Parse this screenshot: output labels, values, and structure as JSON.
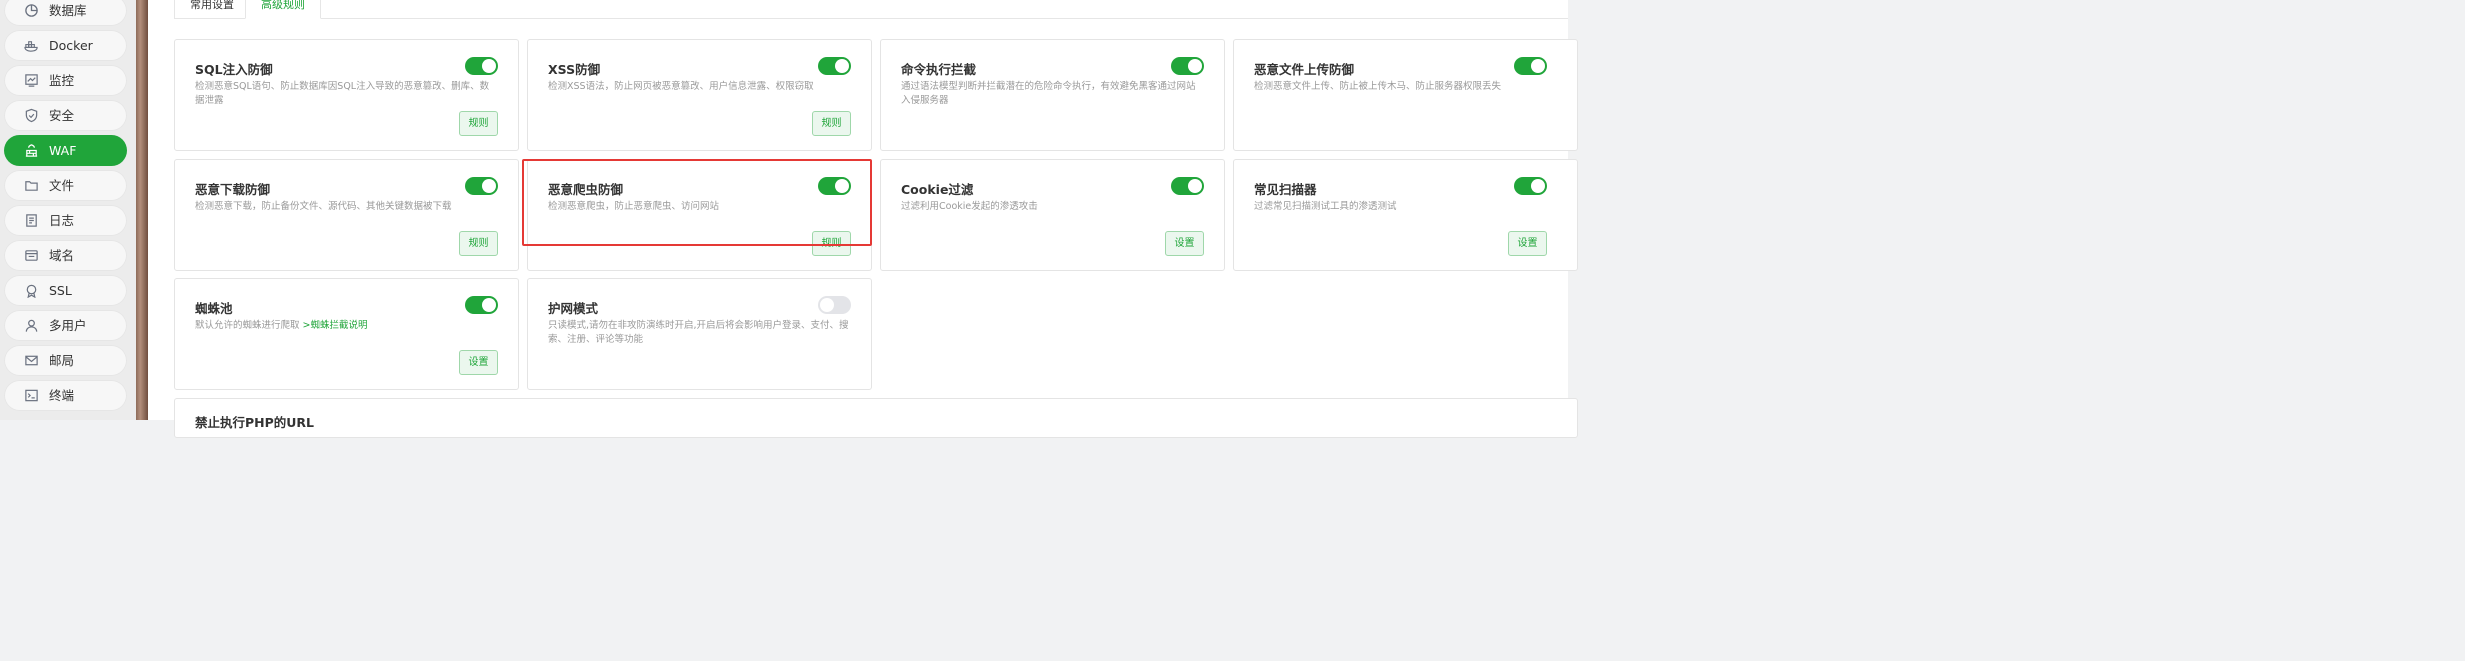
{
  "sidebar": {
    "items": [
      {
        "label": "数据库",
        "icon": "pie-chart-icon",
        "active": false
      },
      {
        "label": "Docker",
        "icon": "docker-icon",
        "active": false
      },
      {
        "label": "监控",
        "icon": "monitor-icon",
        "active": false
      },
      {
        "label": "安全",
        "icon": "shield-icon",
        "active": false
      },
      {
        "label": "WAF",
        "icon": "firewall-icon",
        "active": true
      },
      {
        "label": "文件",
        "icon": "folder-icon",
        "active": false
      },
      {
        "label": "日志",
        "icon": "log-icon",
        "active": false
      },
      {
        "label": "域名",
        "icon": "globe-icon",
        "active": false
      },
      {
        "label": "SSL",
        "icon": "ssl-icon",
        "active": false
      },
      {
        "label": "多用户",
        "icon": "users-icon",
        "active": false
      },
      {
        "label": "邮局",
        "icon": "mail-icon",
        "active": false
      },
      {
        "label": "终端",
        "icon": "terminal-icon",
        "active": false
      }
    ]
  },
  "tabs": [
    {
      "label": "常用设置",
      "active": false
    },
    {
      "label": "高级规则",
      "active": true
    }
  ],
  "cards": [
    {
      "title": "SQL注入防御",
      "desc": "检测恶意SQL语句、防止数据库因SQL注入导致的恶意篡改、删库、数据泄露",
      "enabled": true,
      "button": "规则"
    },
    {
      "title": "XSS防御",
      "desc": "检测XSS语法，防止网页被恶意篡改、用户信息泄露、权限窃取",
      "enabled": true,
      "button": "规则"
    },
    {
      "title": "命令执行拦截",
      "desc": "通过语法模型判断并拦截潜在的危险命令执行，有效避免黑客通过网站入侵服务器",
      "enabled": true,
      "button": ""
    },
    {
      "title": "恶意文件上传防御",
      "desc": "检测恶意文件上传、防止被上传木马、防止服务器权限丢失",
      "enabled": true,
      "button": ""
    },
    {
      "title": "恶意下载防御",
      "desc": "检测恶意下载，防止备份文件、源代码、其他关键数据被下载",
      "enabled": true,
      "button": "规则"
    },
    {
      "title": "恶意爬虫防御",
      "desc": "检测恶意爬虫，防止恶意爬虫、访问网站",
      "enabled": true,
      "button": "规则"
    },
    {
      "title": "Cookie过滤",
      "desc": "过滤利用Cookie发起的渗透攻击",
      "enabled": true,
      "button": "设置"
    },
    {
      "title": "常见扫描器",
      "desc": "过滤常见扫描测试工具的渗透测试",
      "enabled": true,
      "button": "设置"
    },
    {
      "title": "蜘蛛池",
      "desc": "默认允许的蜘蛛进行爬取",
      "desc_link": ">蜘蛛拦截说明",
      "enabled": true,
      "button": "设置"
    },
    {
      "title": "护网模式",
      "desc": "只读模式,请勿在非攻防演练时开启,开启后将会影响用户登录、支付、搜索、注册、评论等功能",
      "enabled": false,
      "button": ""
    }
  ],
  "bottom_card": {
    "title": "禁止执行PHP的URL"
  },
  "colors": {
    "accent": "#20a53a",
    "highlight": "#e53935"
  }
}
